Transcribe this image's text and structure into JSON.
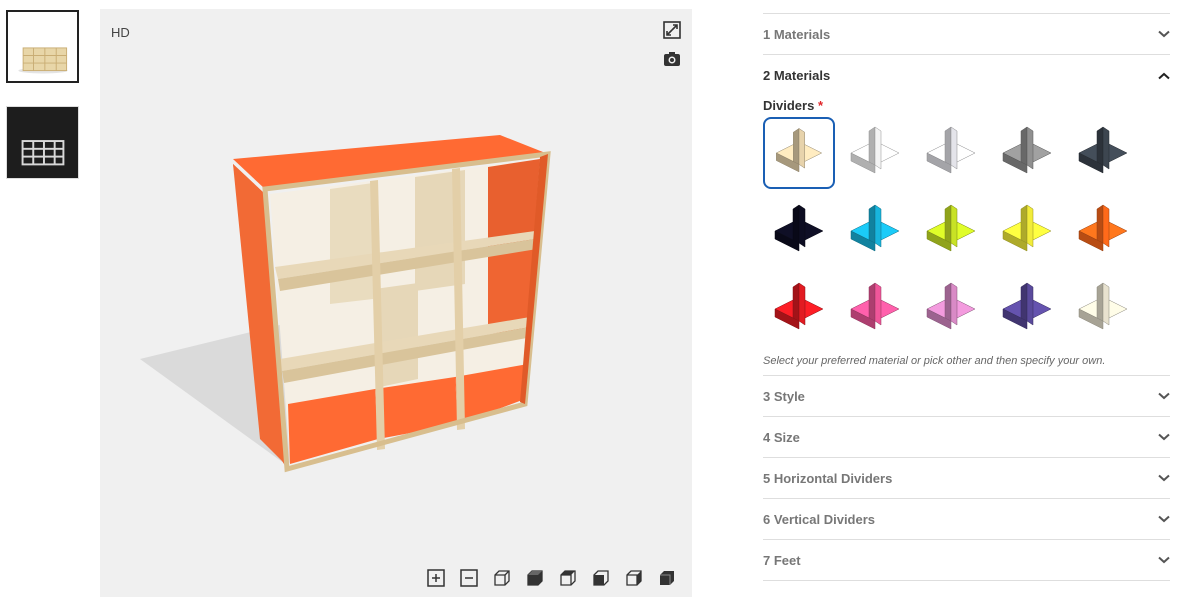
{
  "viewer": {
    "quality_label": "HD",
    "fullscreen_icon": "expand-icon",
    "screenshot_icon": "camera-icon",
    "cabinet_color": "#ff6a33",
    "plywood_color": "#e8d8b8",
    "toolbar": [
      {
        "name": "zoom-in-icon"
      },
      {
        "name": "zoom-out-icon"
      },
      {
        "name": "view-front-icon"
      },
      {
        "name": "view-iso-icon"
      },
      {
        "name": "view-left-icon"
      },
      {
        "name": "view-right-icon"
      },
      {
        "name": "view-back-icon"
      },
      {
        "name": "view-top-icon"
      }
    ]
  },
  "thumbnails": [
    {
      "name": "thumbnail-light",
      "bg": "#ffffff"
    },
    {
      "name": "thumbnail-dark",
      "bg": "#1d1d1d"
    }
  ],
  "panel": {
    "sections": [
      {
        "label": "1 Materials",
        "open": false
      },
      {
        "label": "2 Materials",
        "open": true
      },
      {
        "label": "3 Style",
        "open": false
      },
      {
        "label": "4 Size",
        "open": false
      },
      {
        "label": "5 Horizontal Dividers",
        "open": false
      },
      {
        "label": "6 Vertical Dividers",
        "open": false
      },
      {
        "label": "7 Feet",
        "open": false
      }
    ],
    "dividers_label": "Dividers",
    "required_mark": "*",
    "hint": "Select your preferred material or pick other and then specify your own.",
    "swatches": [
      {
        "color": "#e7d3ac",
        "selected": true
      },
      {
        "color": "#f4f4f4"
      },
      {
        "color": "#e4e4ea"
      },
      {
        "color": "#909090"
      },
      {
        "color": "#3d4650"
      },
      {
        "color": "#0d0d22"
      },
      {
        "color": "#18b5dd"
      },
      {
        "color": "#c8e225"
      },
      {
        "color": "#f2ec3a"
      },
      {
        "color": "#ff6a1a"
      },
      {
        "color": "#e21b22"
      },
      {
        "color": "#f0569a"
      },
      {
        "color": "#d98ac6"
      },
      {
        "color": "#5a4a9c"
      },
      {
        "color": "#e8e2cf"
      }
    ]
  }
}
